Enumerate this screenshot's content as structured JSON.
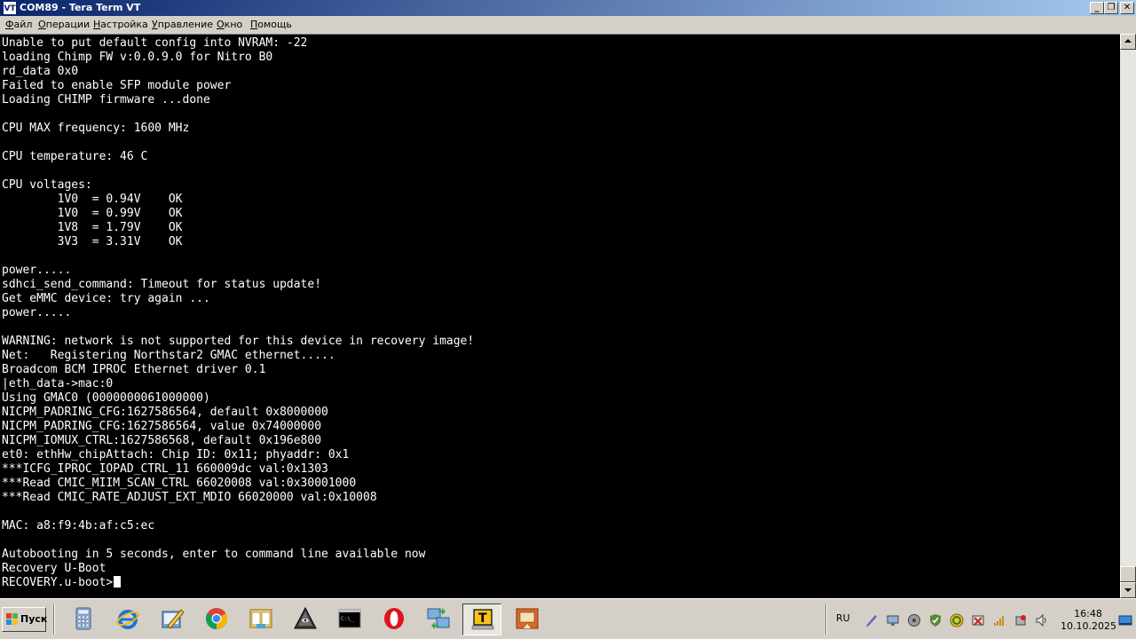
{
  "window": {
    "icon_text": "VT",
    "title": "COM89 - Tera Term VT",
    "controls": {
      "minimize": "_",
      "restore": "❐",
      "close": "✕"
    }
  },
  "menu": {
    "items": [
      {
        "first": "Ф",
        "rest": "айл"
      },
      {
        "first": "О",
        "rest": "перации"
      },
      {
        "first": "Н",
        "rest": "астройка"
      },
      {
        "first": "У",
        "rest": "правление"
      },
      {
        "first": "О",
        "rest": "кно"
      },
      {
        "first": "П",
        "rest": "омощь"
      }
    ]
  },
  "terminal": {
    "lines": [
      "Unable to put default config into NVRAM: -22",
      "loading Chimp FW v:0.0.9.0 for Nitro B0",
      "rd_data 0x0",
      "Failed to enable SFP module power",
      "Loading CHIMP firmware ...done",
      "",
      "CPU MAX frequency: 1600 MHz",
      "",
      "CPU temperature: 46 C",
      "",
      "CPU voltages:",
      "        1V0  = 0.94V    OK",
      "        1V0  = 0.99V    OK",
      "        1V8  = 1.79V    OK",
      "        3V3  = 3.31V    OK",
      "",
      "power.....",
      "sdhci_send_command: Timeout for status update!",
      "Get eMMC device: try again ...",
      "power.....",
      "",
      "WARNING: network is not supported for this device in recovery image!",
      "Net:   Registering Northstar2 GMAC ethernet.....",
      "Broadcom BCM IPROC Ethernet driver 0.1",
      "|eth_data->mac:0",
      "Using GMAC0 (0000000061000000)",
      "NICPM_PADRING_CFG:1627586564, default 0x8000000",
      "NICPM_PADRING_CFG:1627586564, value 0x74000000",
      "NICPM_IOMUX_CTRL:1627586568, default 0x196e800",
      "et0: ethHw_chipAttach: Chip ID: 0x11; phyaddr: 0x1",
      "***ICFG_IPROC_IOPAD_CTRL_11 660009dc val:0x1303",
      "***Read CMIC_MIIM_SCAN_CTRL 66020008 val:0x30001000",
      "***Read CMIC_RATE_ADJUST_EXT_MDIO 66020000 val:0x10008",
      "",
      "MAC: a8:f9:4b:af:c5:ec",
      "",
      "Autobooting in 5 seconds, enter to command line available now",
      "Recovery U-Boot",
      "RECOVERY.u-boot>"
    ]
  },
  "taskbar": {
    "start_label": "Пуск",
    "language": "RU",
    "clock_time": "16:48",
    "clock_date": "10.10.2025",
    "apps": [
      {
        "name": "calculator-icon"
      },
      {
        "name": "internet-explorer-icon"
      },
      {
        "name": "pencil-board-icon"
      },
      {
        "name": "chrome-icon"
      },
      {
        "name": "file-manager-icon"
      },
      {
        "name": "eye-pyramid-icon"
      },
      {
        "name": "command-prompt-icon"
      },
      {
        "name": "opera-icon"
      },
      {
        "name": "network-transfer-icon"
      },
      {
        "name": "teraterm-icon"
      },
      {
        "name": "remote-desktop-icon"
      }
    ],
    "cmd_glyph": "C:\\_"
  },
  "colors": {
    "terminal_bg": "#000000",
    "terminal_fg": "#ffffff",
    "titlebar_start": "#0a246a",
    "titlebar_end": "#a6caf0"
  }
}
